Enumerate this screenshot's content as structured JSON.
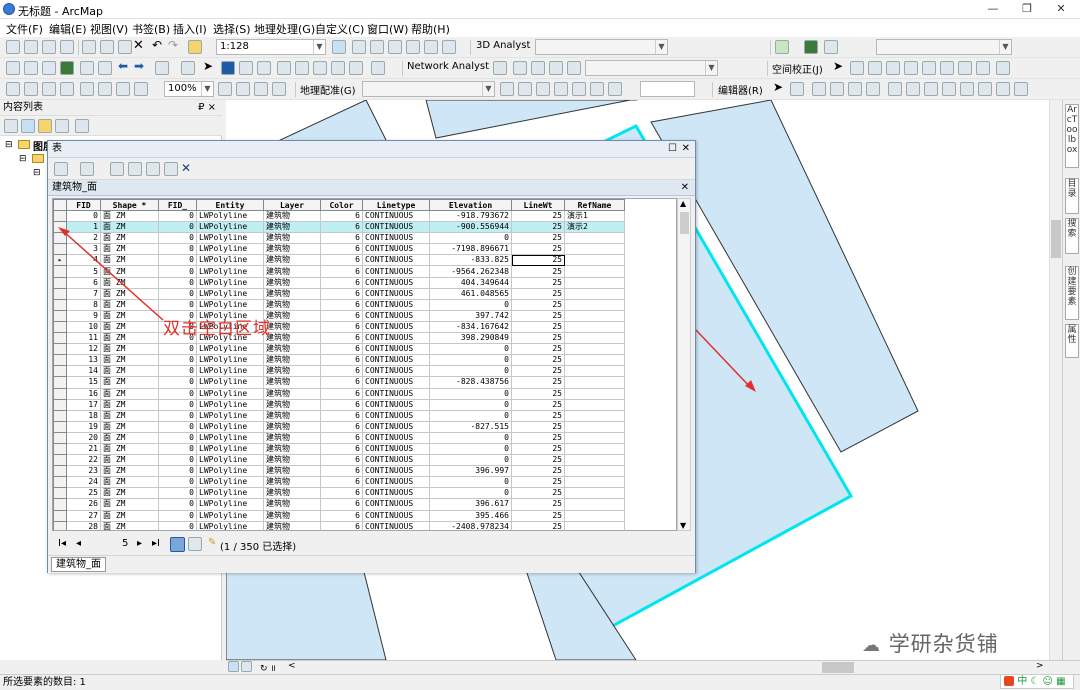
{
  "window": {
    "title": "无标题 - ArcMap",
    "minimize": "—",
    "restore": "❐",
    "close": "✕"
  },
  "menu": [
    "文件(F)",
    "编辑(E)",
    "视图(V)",
    "书签(B)",
    "插入(I)",
    "选择(S)",
    "地理处理(G)",
    "自定义(C)",
    "窗口(W)",
    "帮助(H)"
  ],
  "toolbar": {
    "scale": "1:128",
    "analyst_3d": "3D Analyst",
    "network_analyst": "Network Analyst",
    "spatial_adjust": "空间校正(J)",
    "zoom": "100%",
    "georef": "地理配准(G)",
    "editor": "编辑器(R)"
  },
  "toc": {
    "title": "内容列表",
    "pin": "₽ ×",
    "layer_label": "图层"
  },
  "right_dock": {
    "tab1": "ArcToolbox",
    "tab2": "目录",
    "tab3": "搜索",
    "tab4": "创建要素",
    "tab5": "属性"
  },
  "table_window": {
    "title": "表",
    "layer_tab_title": "建筑物_面",
    "columns": [
      "FID",
      "Shape *",
      "FID_",
      "Entity",
      "Layer",
      "Color",
      "Linetype",
      "Elevation",
      "LineWt",
      "RefName"
    ],
    "rows": [
      [
        "0",
        "面 ZM",
        "0",
        "LWPolyline",
        "建筑物",
        "6",
        "CONTINUOUS",
        "-918.793672",
        "25",
        "演示1"
      ],
      [
        "1",
        "面 ZM",
        "0",
        "LWPolyline",
        "建筑物",
        "6",
        "CONTINUOUS",
        "-900.556944",
        "25",
        "演示2"
      ],
      [
        "2",
        "面 ZM",
        "0",
        "LWPolyline",
        "建筑物",
        "6",
        "CONTINUOUS",
        "0",
        "25",
        ""
      ],
      [
        "3",
        "面 ZM",
        "0",
        "LWPolyline",
        "建筑物",
        "6",
        "CONTINUOUS",
        "-7198.896671",
        "25",
        ""
      ],
      [
        "4",
        "面 ZM",
        "0",
        "LWPolyline",
        "建筑物",
        "6",
        "CONTINUOUS",
        "-833.825",
        "25",
        ""
      ],
      [
        "5",
        "面 ZM",
        "0",
        "LWPolyline",
        "建筑物",
        "6",
        "CONTINUOUS",
        "-9564.262348",
        "25",
        ""
      ],
      [
        "6",
        "面 ZM",
        "0",
        "LWPolyline",
        "建筑物",
        "6",
        "CONTINUOUS",
        "404.349644",
        "25",
        ""
      ],
      [
        "7",
        "面 ZM",
        "0",
        "LWPolyline",
        "建筑物",
        "6",
        "CONTINUOUS",
        "461.048565",
        "25",
        ""
      ],
      [
        "8",
        "面 ZM",
        "0",
        "LWPolyline",
        "建筑物",
        "6",
        "CONTINUOUS",
        "0",
        "25",
        ""
      ],
      [
        "9",
        "面 ZM",
        "0",
        "LWPolyline",
        "建筑物",
        "6",
        "CONTINUOUS",
        "397.742",
        "25",
        ""
      ],
      [
        "10",
        "面 ZM",
        "0",
        "LWPolyline",
        "建筑物",
        "6",
        "CONTINUOUS",
        "-834.167642",
        "25",
        ""
      ],
      [
        "11",
        "面 ZM",
        "0",
        "LWPolyline",
        "建筑物",
        "6",
        "CONTINUOUS",
        "398.290849",
        "25",
        ""
      ],
      [
        "12",
        "面 ZM",
        "0",
        "LWPolyline",
        "建筑物",
        "6",
        "CONTINUOUS",
        "0",
        "25",
        ""
      ],
      [
        "13",
        "面 ZM",
        "0",
        "LWPolyline",
        "建筑物",
        "6",
        "CONTINUOUS",
        "0",
        "25",
        ""
      ],
      [
        "14",
        "面 ZM",
        "0",
        "LWPolyline",
        "建筑物",
        "6",
        "CONTINUOUS",
        "0",
        "25",
        ""
      ],
      [
        "15",
        "面 ZM",
        "0",
        "LWPolyline",
        "建筑物",
        "6",
        "CONTINUOUS",
        "-828.438756",
        "25",
        ""
      ],
      [
        "16",
        "面 ZM",
        "0",
        "LWPolyline",
        "建筑物",
        "6",
        "CONTINUOUS",
        "0",
        "25",
        ""
      ],
      [
        "17",
        "面 ZM",
        "0",
        "LWPolyline",
        "建筑物",
        "6",
        "CONTINUOUS",
        "0",
        "25",
        ""
      ],
      [
        "18",
        "面 ZM",
        "0",
        "LWPolyline",
        "建筑物",
        "6",
        "CONTINUOUS",
        "0",
        "25",
        ""
      ],
      [
        "19",
        "面 ZM",
        "0",
        "LWPolyline",
        "建筑物",
        "6",
        "CONTINUOUS",
        "-827.515",
        "25",
        ""
      ],
      [
        "20",
        "面 ZM",
        "0",
        "LWPolyline",
        "建筑物",
        "6",
        "CONTINUOUS",
        "0",
        "25",
        ""
      ],
      [
        "21",
        "面 ZM",
        "0",
        "LWPolyline",
        "建筑物",
        "6",
        "CONTINUOUS",
        "0",
        "25",
        ""
      ],
      [
        "22",
        "面 ZM",
        "0",
        "LWPolyline",
        "建筑物",
        "6",
        "CONTINUOUS",
        "0",
        "25",
        ""
      ],
      [
        "23",
        "面 ZM",
        "0",
        "LWPolyline",
        "建筑物",
        "6",
        "CONTINUOUS",
        "396.997",
        "25",
        ""
      ],
      [
        "24",
        "面 ZM",
        "0",
        "LWPolyline",
        "建筑物",
        "6",
        "CONTINUOUS",
        "0",
        "25",
        ""
      ],
      [
        "25",
        "面 ZM",
        "0",
        "LWPolyline",
        "建筑物",
        "6",
        "CONTINUOUS",
        "0",
        "25",
        ""
      ],
      [
        "26",
        "面 ZM",
        "0",
        "LWPolyline",
        "建筑物",
        "6",
        "CONTINUOUS",
        "396.617",
        "25",
        ""
      ],
      [
        "27",
        "面 ZM",
        "0",
        "LWPolyline",
        "建筑物",
        "6",
        "CONTINUOUS",
        "395.466",
        "25",
        ""
      ],
      [
        "28",
        "面 ZM",
        "0",
        "LWPolyline",
        "建筑物",
        "6",
        "CONTINUOUS",
        "-2408.978234",
        "25",
        ""
      ]
    ],
    "highlighted_row": 1,
    "current_row": 4,
    "nav": {
      "first": "I◂",
      "prev": "◂",
      "page": "5",
      "next": "▸",
      "last": "▸I"
    },
    "selection_status": "(1 / 350 已选择)",
    "tab_label": "建筑物_面"
  },
  "annotation": {
    "text": "双击空白区域",
    "color": "#e0312b"
  },
  "status_bar": {
    "text": "所选要素的数目: 1"
  },
  "watermark": {
    "text": "学研杂货铺"
  },
  "colors": {
    "building_fill": "#cfe6f7",
    "selected_outline": "#00e5ee",
    "highlight_row": "#bfeff3"
  }
}
